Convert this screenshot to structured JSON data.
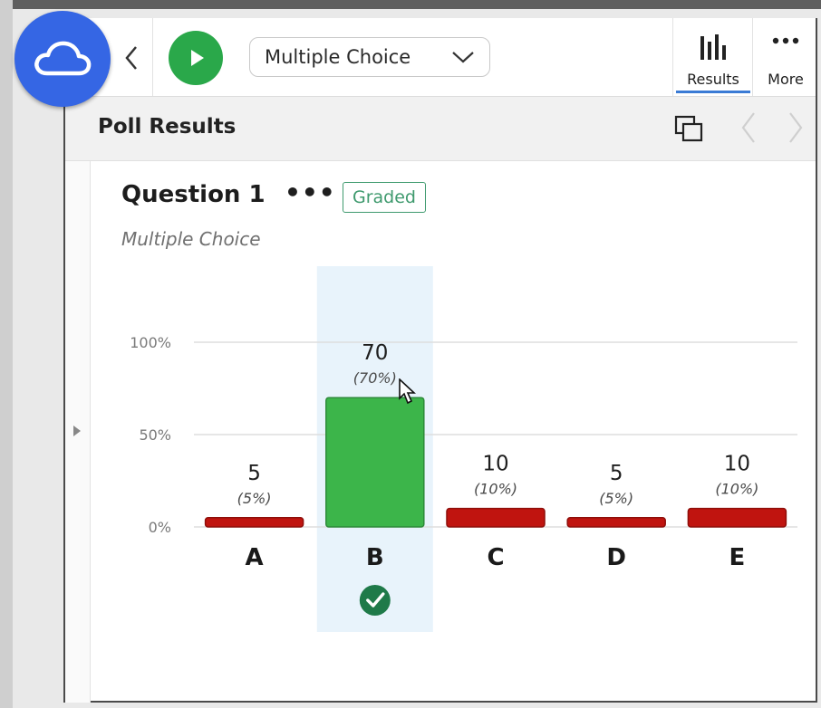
{
  "toolbar": {
    "question_type_select": "Multiple Choice",
    "results_label": "Results",
    "more_label": "More"
  },
  "results_header": {
    "title": "Poll Results"
  },
  "question": {
    "title": "Question 1",
    "menu_glyph": "•••",
    "badge": "Graded",
    "type": "Multiple Choice"
  },
  "colors": {
    "accent_blue": "#3566e4",
    "play_green": "#2aa84a",
    "correct_green": "#3cb54a",
    "incorrect_red": "#c0140f",
    "badge_green": "#3f9a6e",
    "correct_column_highlight": "#e8f3fb"
  },
  "icons": [
    "cloud-icon",
    "chevron-left-icon",
    "play-icon",
    "chevron-down-icon",
    "bar-chart-icon",
    "more-dots-icon",
    "popout-icon",
    "nav-prev-icon",
    "nav-next-icon",
    "expand-panel-icon",
    "checkmark-icon",
    "mouse-cursor-icon"
  ],
  "chart_data": {
    "type": "bar",
    "categories": [
      "A",
      "B",
      "C",
      "D",
      "E"
    ],
    "values": [
      5,
      70,
      10,
      5,
      10
    ],
    "percent_labels": [
      "(5%)",
      "(70%)",
      "(10%)",
      "(5%)",
      "(10%)"
    ],
    "correct_index": 1,
    "y_ticks": [
      "0%",
      "50%",
      "100%"
    ],
    "ylim": [
      0,
      100
    ],
    "grid": true
  }
}
